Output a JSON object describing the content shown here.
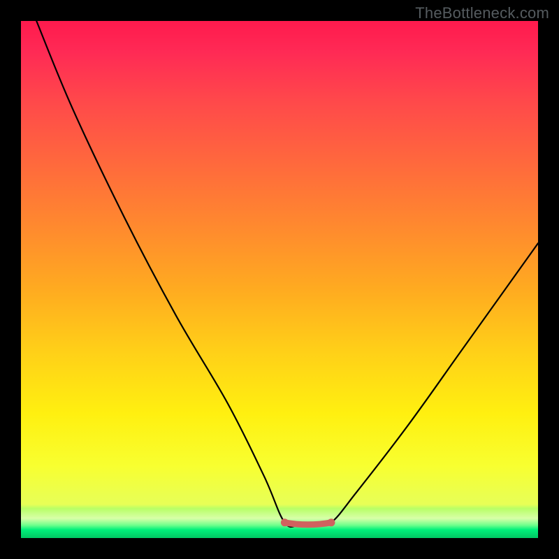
{
  "watermark": {
    "text": "TheBottleneck.com"
  },
  "chart_data": {
    "type": "line",
    "title": "",
    "xlabel": "",
    "ylabel": "",
    "xlim": [
      0,
      100
    ],
    "ylim": [
      0,
      100
    ],
    "grid": false,
    "legend": false,
    "flat_region": {
      "start_x": 51,
      "end_x": 60,
      "y": 3
    },
    "series": [
      {
        "name": "bottleneck-curve",
        "x": [
          3,
          10,
          20,
          30,
          40,
          47,
          51,
          54,
          57,
          60,
          65,
          75,
          85,
          95,
          100
        ],
        "y": [
          100,
          83,
          62,
          43,
          26,
          12,
          3,
          2.6,
          2.6,
          3,
          9,
          22,
          36,
          50,
          57
        ]
      }
    ],
    "annotations": [
      {
        "name": "flat-marker",
        "color": "#d0625f",
        "thickness": 8
      }
    ],
    "gradient_stops": [
      {
        "pos": 0,
        "color": "#ff1a4d"
      },
      {
        "pos": 50,
        "color": "#ffab20"
      },
      {
        "pos": 80,
        "color": "#fff010"
      },
      {
        "pos": 97,
        "color": "#6fff8c"
      },
      {
        "pos": 100,
        "color": "#00c864"
      }
    ]
  }
}
